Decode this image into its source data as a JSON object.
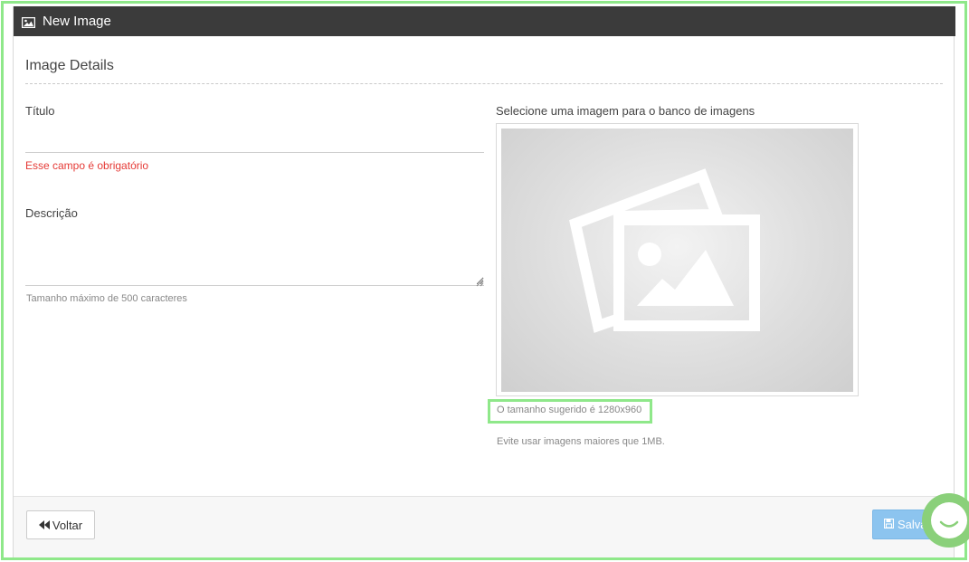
{
  "header": {
    "title": "New Image",
    "icon": "image-icon"
  },
  "section": {
    "title": "Image Details"
  },
  "form": {
    "title_label": "Título",
    "title_value": "",
    "title_error": "Esse campo é obrigatório",
    "description_label": "Descrição",
    "description_value": "",
    "description_hint": "Tamanho máximo de 500 caracteres"
  },
  "image": {
    "label": "Selecione uma imagem para o banco de imagens",
    "placeholder_icon": "images-placeholder-icon",
    "size_hint": "O tamanho sugerido é 1280x960",
    "max_hint": "Evite usar imagens maiores que 1MB."
  },
  "footer": {
    "back_label": "Voltar",
    "back_icon": "fast-backward-icon",
    "save_label": "Salvar",
    "save_icon": "floppy-disk-icon"
  },
  "colors": {
    "header_bg": "#3b3b3b",
    "error": "#e53935",
    "save_button": "#8cc4ef",
    "highlight": "#8fe88a",
    "chat_widget": "#8ad07a"
  },
  "chat": {
    "icon": "chat-icon"
  }
}
